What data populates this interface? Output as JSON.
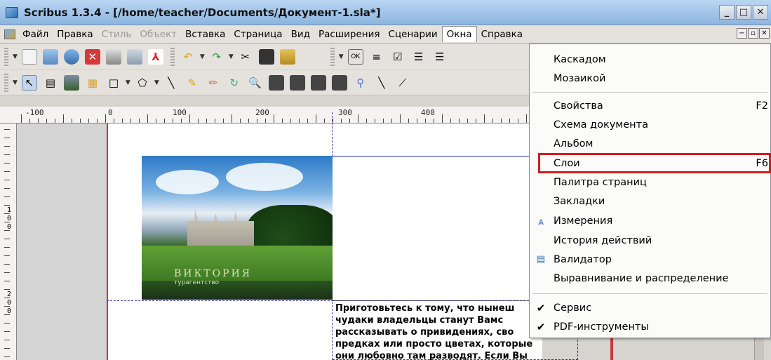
{
  "window": {
    "title": "Scribus 1.3.4 - [/home/teacher/Documents/Документ-1.sla*]",
    "buttons": [
      "_",
      "□",
      "✕"
    ]
  },
  "menubar": {
    "items": [
      {
        "label": "Файл",
        "disabled": false
      },
      {
        "label": "Правка",
        "disabled": false
      },
      {
        "label": "Стиль",
        "disabled": true
      },
      {
        "label": "Объект",
        "disabled": true
      },
      {
        "label": "Вставка",
        "disabled": false
      },
      {
        "label": "Страница",
        "disabled": false
      },
      {
        "label": "Вид",
        "disabled": false
      },
      {
        "label": "Расширения",
        "disabled": false
      },
      {
        "label": "Сценарии",
        "disabled": false
      },
      {
        "label": "Окна",
        "disabled": false
      },
      {
        "label": "Справка",
        "disabled": false
      }
    ],
    "mdi_buttons": [
      "−",
      "▫",
      "✕"
    ]
  },
  "ruler": {
    "labels": [
      "-100",
      "0",
      "100",
      "200",
      "300",
      "400"
    ]
  },
  "vruler": {
    "labels": [
      "1",
      "0",
      "0",
      "2",
      "0",
      "0"
    ]
  },
  "image": {
    "logo": "ВИКТОРИЯ",
    "logo_sub": "турагентство"
  },
  "text_frame": {
    "lines": [
      "Приготовьтесь к тому, что нынеш",
      "чудаки владельцы станут Вамс",
      "рассказывать о привидениях, сво",
      "предках или просто цветах, которые",
      "они любовно там разводят. Если Вы"
    ]
  },
  "dropdown": {
    "items": [
      {
        "label": "Каскадом",
        "shortcut": "",
        "icon": ""
      },
      {
        "label": "Мозаикой",
        "shortcut": "",
        "icon": ""
      },
      {
        "label": "Свойства",
        "shortcut": "F2",
        "icon": ""
      },
      {
        "label": "Схема документа",
        "shortcut": "",
        "icon": ""
      },
      {
        "label": "Альбом",
        "shortcut": "",
        "icon": ""
      },
      {
        "label": "Слои",
        "shortcut": "F6",
        "icon": ""
      },
      {
        "label": "Палитра страниц",
        "shortcut": "",
        "icon": ""
      },
      {
        "label": "Закладки",
        "shortcut": "",
        "icon": ""
      },
      {
        "label": "Измерения",
        "shortcut": "",
        "icon": "measure-icon"
      },
      {
        "label": "История действий",
        "shortcut": "",
        "icon": ""
      },
      {
        "label": "Валидатор",
        "shortcut": "",
        "icon": "validator-icon"
      },
      {
        "label": "Выравнивание и распределение",
        "shortcut": "",
        "icon": ""
      },
      {
        "label": "Сервис",
        "shortcut": "",
        "icon": "check-icon"
      },
      {
        "label": "PDF-инструменты",
        "shortcut": "",
        "icon": "check-icon"
      }
    ]
  },
  "colors": {
    "highlight_border": "#d21e1e",
    "titlebar": "#9fc2e8"
  }
}
